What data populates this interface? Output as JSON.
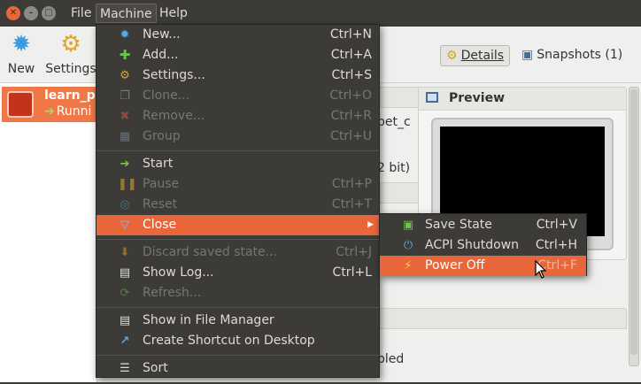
{
  "menubar": {
    "items": [
      "File",
      "Machine",
      "Help"
    ]
  },
  "toolbar": {
    "new_label": "New",
    "settings_label": "Settings",
    "details_label": "Details",
    "snapshots_label": "Snapshots (1)"
  },
  "vm": {
    "name": "learn_pu",
    "state": "Runni"
  },
  "details": {
    "frag_1": "pet_c",
    "frag_2": "2 bit)",
    "frag_3": "bled",
    "preview_title": "Preview"
  },
  "machine_menu": {
    "items": [
      {
        "label": "New...",
        "shortcut": "Ctrl+N",
        "icon": "new-star-icon"
      },
      {
        "label": "Add...",
        "shortcut": "Ctrl+A",
        "icon": "plus-icon"
      },
      {
        "label": "Settings...",
        "shortcut": "Ctrl+S",
        "icon": "gear-icon"
      },
      {
        "label": "Clone...",
        "shortcut": "Ctrl+O",
        "icon": "clone-icon",
        "disabled": true
      },
      {
        "label": "Remove...",
        "shortcut": "Ctrl+R",
        "icon": "remove-x-icon",
        "disabled": true
      },
      {
        "label": "Group",
        "shortcut": "Ctrl+U",
        "icon": "group-icon",
        "disabled": true
      },
      {
        "label": "Start",
        "shortcut": "",
        "icon": "start-arrow-icon"
      },
      {
        "label": "Pause",
        "shortcut": "Ctrl+P",
        "icon": "pause-icon",
        "disabled": true
      },
      {
        "label": "Reset",
        "shortcut": "Ctrl+T",
        "icon": "reset-icon",
        "disabled": true
      },
      {
        "label": "Close",
        "shortcut": "",
        "icon": "close-triangle-icon",
        "highlighted": true
      },
      {
        "label": "Discard saved state...",
        "shortcut": "Ctrl+J",
        "icon": "discard-icon",
        "disabled": true
      },
      {
        "label": "Show Log...",
        "shortcut": "Ctrl+L",
        "icon": "log-icon"
      },
      {
        "label": "Refresh...",
        "shortcut": "",
        "icon": "refresh-icon",
        "disabled": true
      },
      {
        "label": "Show in File Manager",
        "shortcut": "",
        "icon": "file-manager-icon"
      },
      {
        "label": "Create Shortcut on Desktop",
        "shortcut": "",
        "icon": "shortcut-icon"
      },
      {
        "label": "Sort",
        "shortcut": "",
        "icon": "sort-icon"
      }
    ]
  },
  "close_submenu": {
    "items": [
      {
        "label": "Save State",
        "shortcut": "Ctrl+V",
        "icon": "save-state-icon"
      },
      {
        "label": "ACPI Shutdown",
        "shortcut": "Ctrl+H",
        "icon": "power-icon"
      },
      {
        "label": "Power Off",
        "shortcut": "Ctrl+F",
        "icon": "power-off-bolt-icon",
        "highlighted": true
      }
    ]
  },
  "colors": {
    "highlight": "#e8663a",
    "menu_bg": "#3c3b37",
    "menu_text": "#dfdbd2",
    "disabled_text": "#777671"
  }
}
